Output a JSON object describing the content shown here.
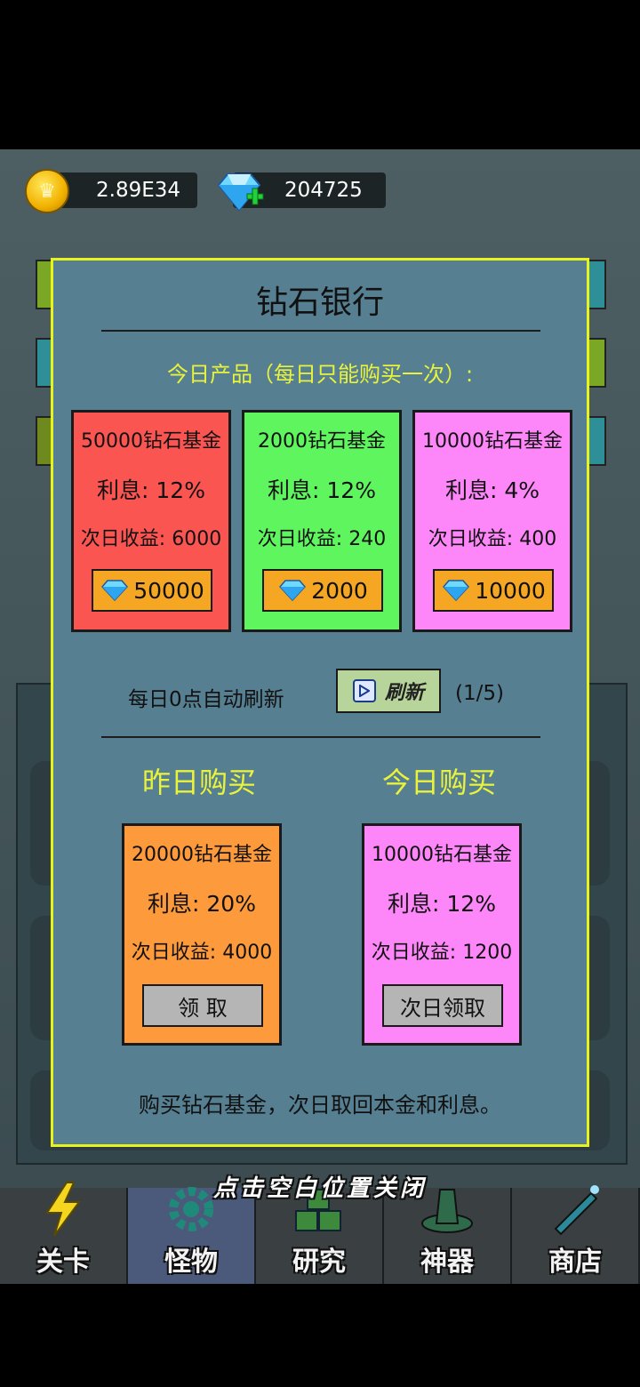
{
  "resources": {
    "coins": "2.89E34",
    "gems": "204725"
  },
  "dialog": {
    "title": "钻石银行",
    "subtitle": "今日产品（每日只能购买一次）:",
    "products": [
      {
        "name": "50000钻石基金",
        "rate": "利息: 12%",
        "gain": "次日收益: 6000",
        "price": "50000",
        "color": "#fb5552"
      },
      {
        "name": "2000钻石基金",
        "rate": "利息: 12%",
        "gain": "次日收益: 240",
        "price": "2000",
        "color": "#5ff55f"
      },
      {
        "name": "10000钻石基金",
        "rate": "利息: 4%",
        "gain": "次日收益: 400",
        "price": "10000",
        "color": "#fd86f9"
      }
    ],
    "refresh": {
      "label": "每日0点自动刷新",
      "button": "刷新",
      "count": "(1/5)"
    },
    "yesterday": {
      "heading": "昨日购买",
      "name": "20000钻石基金",
      "rate": "利息: 20%",
      "gain": "次日收益: 4000",
      "button": "领 取",
      "color": "#fd9a3c"
    },
    "today": {
      "heading": "今日购买",
      "name": "10000钻石基金",
      "rate": "利息: 12%",
      "gain": "次日收益: 1200",
      "button": "次日领取",
      "color": "#fd86f9"
    },
    "footer": "购买钻石基金，次日取回本金和利息。"
  },
  "close_hint": "点击空白位置关闭",
  "nav": [
    {
      "label": "关卡",
      "icon": "lightning-icon"
    },
    {
      "label": "怪物",
      "icon": "gear-icon",
      "active": true
    },
    {
      "label": "研究",
      "icon": "blocks-icon"
    },
    {
      "label": "神器",
      "icon": "hat-icon"
    },
    {
      "label": "商店",
      "icon": "bottle-icon"
    }
  ]
}
